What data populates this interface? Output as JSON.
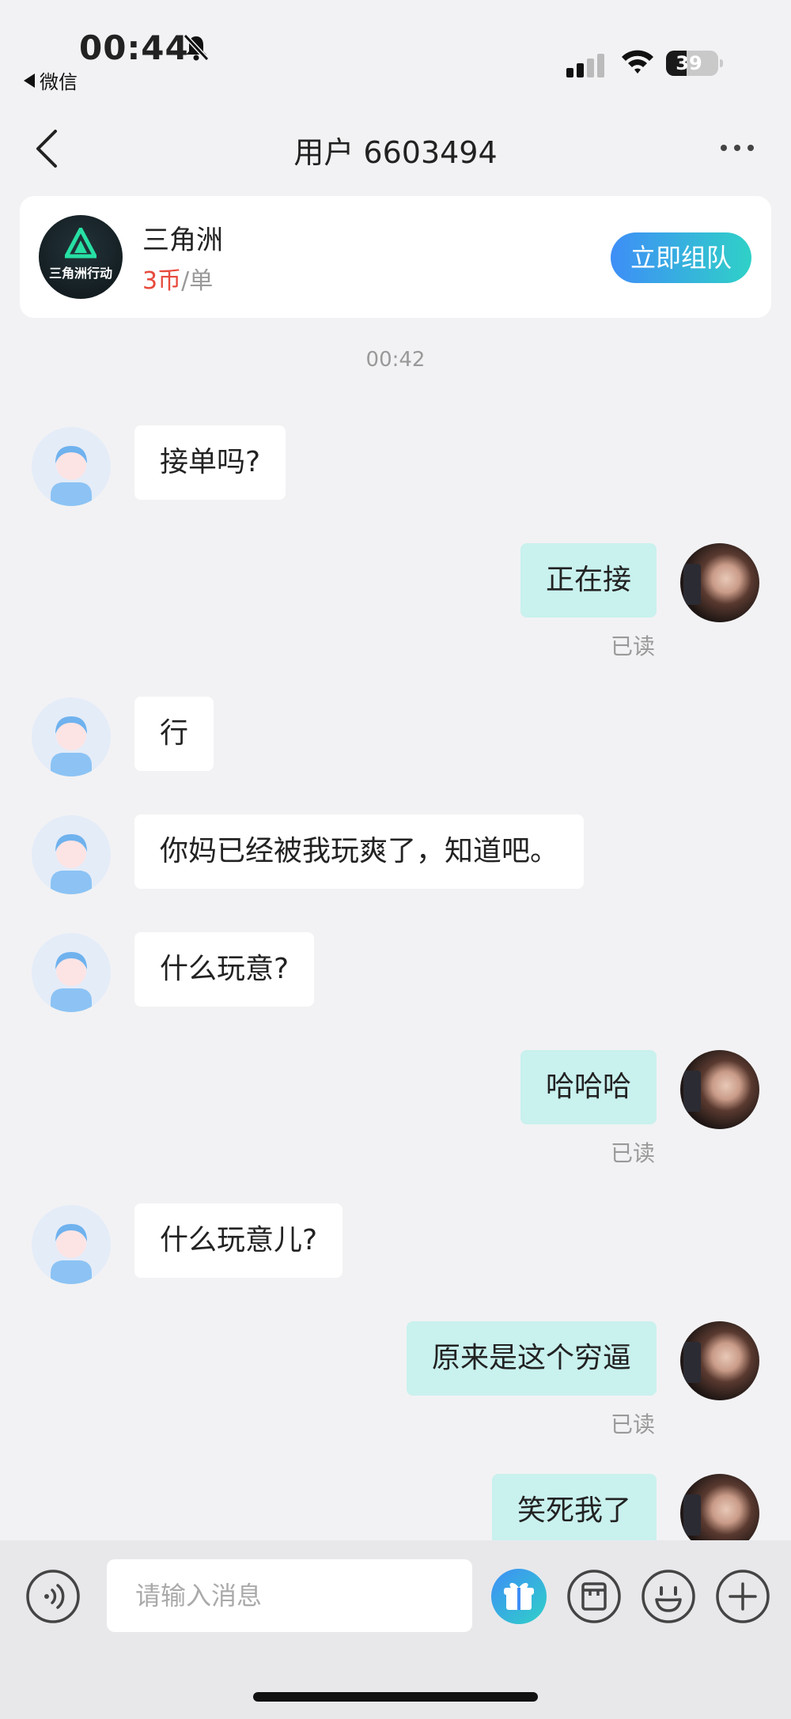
{
  "status_bar": {
    "time": "00:44",
    "back_app": "微信",
    "battery": "39",
    "battery_level": 0.39
  },
  "nav": {
    "title": "用户 6603494"
  },
  "order_card": {
    "game_name": "三角洲",
    "logo_text": "三角洲行动",
    "price_value": "3币",
    "price_unit": "/单",
    "team_button": "立即组队"
  },
  "chat": {
    "timestamp": "00:42",
    "read_label": "已读",
    "messages": [
      {
        "side": "left",
        "text": "接单吗?"
      },
      {
        "side": "right",
        "text": "正在接",
        "read": true
      },
      {
        "side": "left",
        "text": "行"
      },
      {
        "side": "left",
        "text": "你妈已经被我玩爽了，知道吧。"
      },
      {
        "side": "left",
        "text": "什么玩意?"
      },
      {
        "side": "right",
        "text": "哈哈哈",
        "read": true
      },
      {
        "side": "left",
        "text": "什么玩意儿?"
      },
      {
        "side": "right",
        "text": "原来是这个穷逼",
        "read": true
      },
      {
        "side": "right",
        "text": "笑死我了"
      }
    ]
  },
  "input_bar": {
    "placeholder": "请输入消息",
    "icons": [
      "voice-icon",
      "gift-icon",
      "album-icon",
      "emoji-icon",
      "plus-icon"
    ],
    "accent_gradient": [
      "#3e8ef7",
      "#2fd1c7"
    ]
  },
  "colors": {
    "background": "#f2f2f4",
    "my_bubble": "#c9f1ee",
    "their_bubble": "#ffffff",
    "price_red": "#e74a3c"
  }
}
